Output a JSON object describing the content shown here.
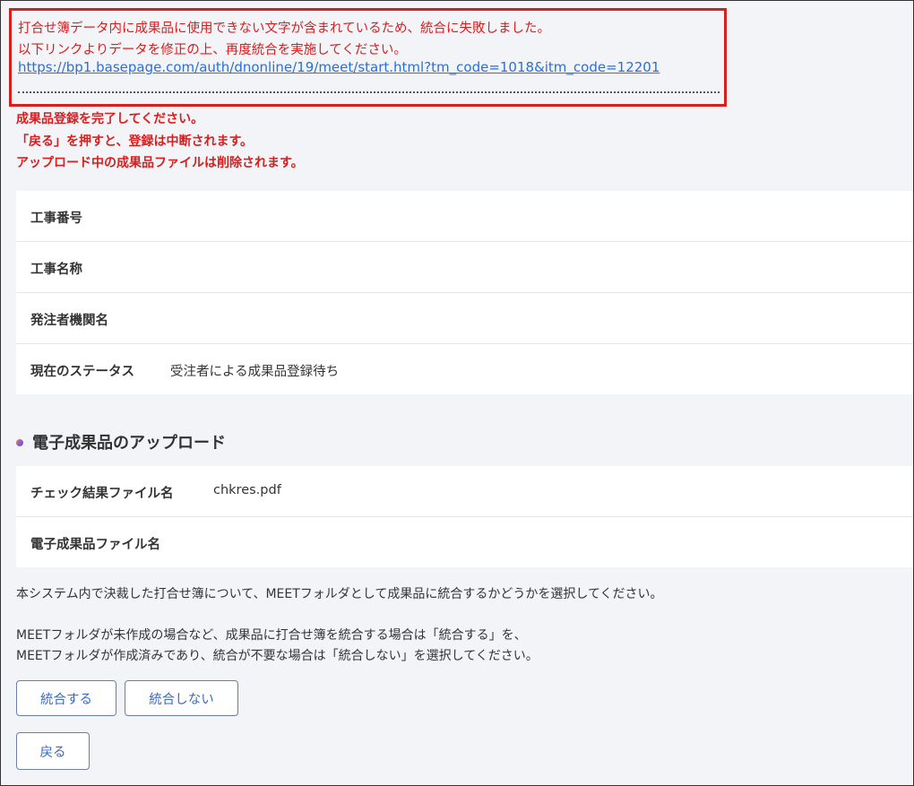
{
  "error_box": {
    "line1": "打合せ簿データ内に成果品に使用できない文字が含まれているため、統合に失敗しました。",
    "line2": "以下リンクよりデータを修正の上、再度統合を実施してください。",
    "link": "https://bp1.basepage.com/auth/dnonline/19/meet/start.html?tm_code=1018&itm_code=12201"
  },
  "warnings": [
    "成果品登録を完了してください。",
    "「戻る」を押すと、登録は中断されます。",
    "アップロード中の成果品ファイルは削除されます。"
  ],
  "info": {
    "construction_number_label": "工事番号",
    "construction_number_value": "",
    "construction_name_label": "工事名称",
    "construction_name_value": "",
    "client_org_label": "発注者機関名",
    "client_org_value": "",
    "status_label": "現在のステータス",
    "status_value": "受注者による成果品登録待ち"
  },
  "upload_section": {
    "title": "電子成果品のアップロード",
    "check_file_label": "チェック結果ファイル名",
    "check_file_value": "chkres.pdf",
    "deliverable_file_label": "電子成果品ファイル名",
    "deliverable_file_value": ""
  },
  "description": {
    "line1": "本システム内で決裁した打合せ簿について、MEETフォルダとして成果品に統合するかどうかを選択してください。",
    "line2": "MEETフォルダが未作成の場合など、成果品に打合せ簿を統合する場合は「統合する」を、",
    "line3": "MEETフォルダが作成済みであり、統合が不要な場合は「統合しない」を選択してください。"
  },
  "buttons": {
    "integrate": "統合する",
    "no_integrate": "統合しない",
    "back": "戻る"
  },
  "colors": {
    "error_red": "#d91e1e",
    "link_blue": "#2a6fd6",
    "button_text": "#3a68c2",
    "background": "#f3f4f8"
  }
}
